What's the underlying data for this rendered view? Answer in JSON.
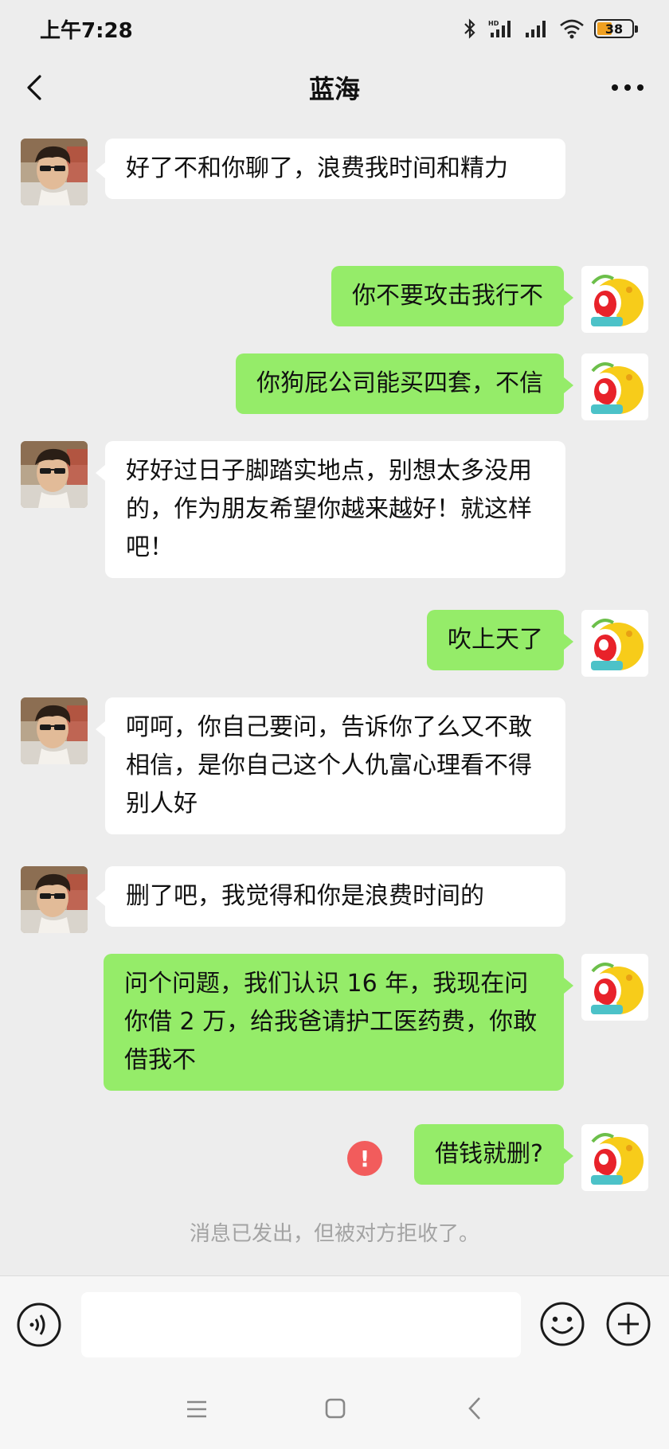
{
  "status_bar": {
    "time": "上午7:28",
    "hd_label": "HD",
    "battery_level": "38",
    "icons": [
      "bluetooth-icon",
      "signal-hd-icon",
      "signal-icon",
      "wifi-icon",
      "battery-icon"
    ]
  },
  "header": {
    "title": "蓝海",
    "back_icon": "chevron-left-icon",
    "more_icon": "more-dots-icon"
  },
  "messages": [
    {
      "side": "in",
      "text": "好了不和你聊了，浪费我时间和精力"
    },
    {
      "side": "out",
      "text": "你不要攻击我行不"
    },
    {
      "side": "out",
      "text": "你狗屁公司能买四套，不信"
    },
    {
      "side": "in",
      "text": "好好过日子脚踏实地点，别想太多没用的，作为朋友希望你越来越好！就这样吧！"
    },
    {
      "side": "out",
      "text": "吹上天了"
    },
    {
      "side": "in",
      "text": "呵呵，你自己要问，告诉你了么又不敢相信，是你自己这个人仇富心理看不得别人好"
    },
    {
      "side": "in",
      "text": "删了吧，我觉得和你是浪费时间的"
    },
    {
      "side": "out",
      "text": "问个问题，我们认识 16 年，我现在问你借 2 万，给我爸请护工医药费，你敢借我不"
    },
    {
      "side": "out",
      "text": "借钱就删?",
      "failed": true
    }
  ],
  "system_note": "消息已发出，但被对方拒收了。",
  "input_bar": {
    "voice_icon": "voice-icon",
    "input_value": "",
    "emoji_icon": "emoji-icon",
    "plus_icon": "plus-icon"
  },
  "nav_buttons": [
    "menu-icon",
    "home-icon",
    "back-icon"
  ],
  "colors": {
    "background": "#ededed",
    "incoming_bubble": "#ffffff",
    "outgoing_bubble": "#95ec69",
    "error": "#f25c5c",
    "note_text": "#a3a3a3"
  }
}
